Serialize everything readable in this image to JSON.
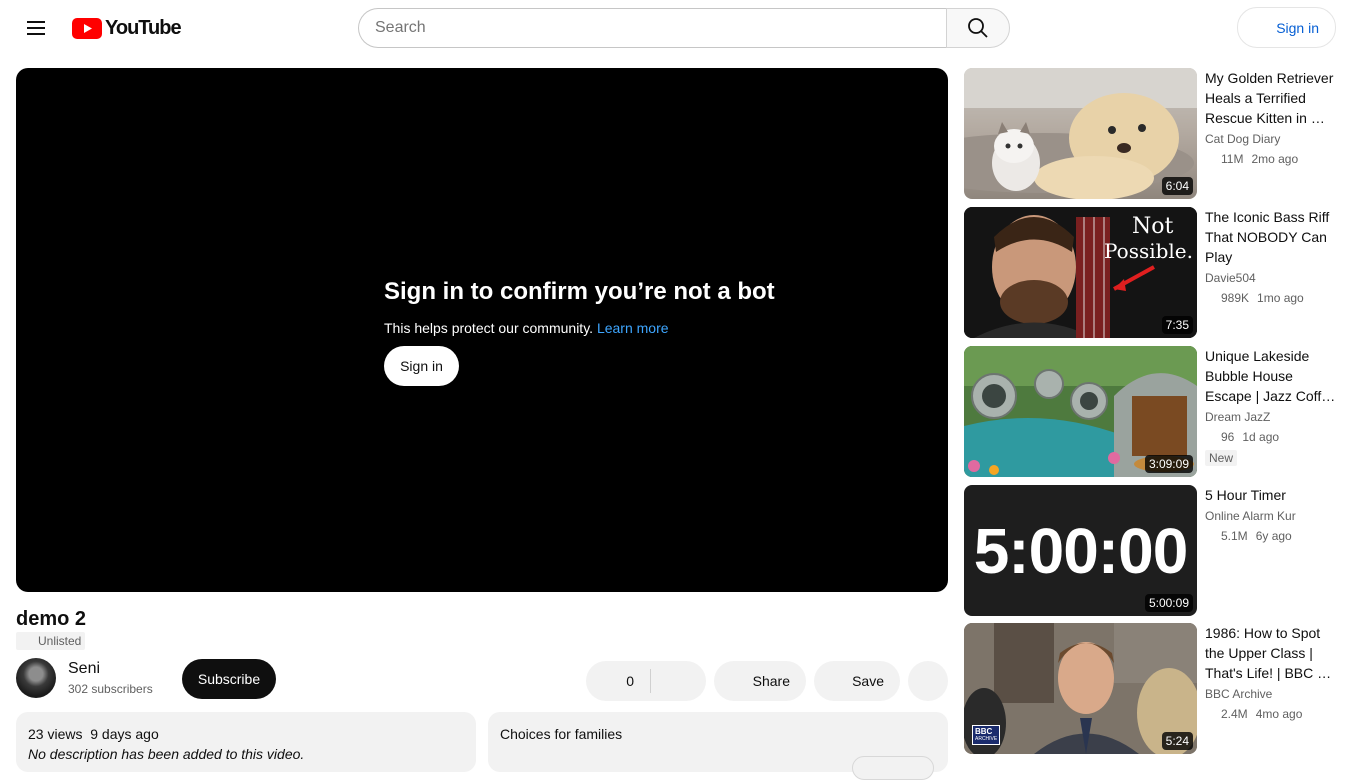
{
  "header": {
    "logo_text": "YouTube",
    "search_placeholder": "Search",
    "signin_label": "Sign in"
  },
  "player": {
    "prompt_title": "Sign in to confirm you’re not a bot",
    "prompt_text": "This helps protect our community.",
    "learn_more": "Learn more",
    "signin_label": "Sign in"
  },
  "video": {
    "title": "demo 2",
    "visibility": "Unlisted",
    "channel_name": "Seni",
    "subscribers": "302 subscribers",
    "subscribe_label": "Subscribe",
    "like_count": "0",
    "share_label": "Share",
    "save_label": "Save",
    "views": "23 views",
    "age": "9 days ago",
    "description": "No description has been added to this video.",
    "families_label": "Choices for families"
  },
  "recommendations": [
    {
      "title": "My Golden Retriever Heals a Terrified Rescue Kitten in …",
      "channel": "Cat Dog Diary",
      "views": "11M",
      "age": "2mo ago",
      "duration": "6:04",
      "badge": ""
    },
    {
      "title": "The Iconic Bass Riff That NOBODY Can Play",
      "channel": "Davie504",
      "views": "989K",
      "age": "1mo ago",
      "duration": "7:35",
      "badge": "",
      "thumb_text_1": "Not",
      "thumb_text_2": "Possible."
    },
    {
      "title": "Unique Lakeside Bubble House Escape | Jazz Coff…",
      "channel": "Dream JazZ",
      "views": "96",
      "age": "1d ago",
      "duration": "3:09:09",
      "badge": "New"
    },
    {
      "title": "5 Hour Timer",
      "channel": "Online Alarm Kur",
      "views": "5.1M",
      "age": "6y ago",
      "duration": "5:00:09",
      "badge": "",
      "thumb_text_1": "5:00:00"
    },
    {
      "title": "1986: How to Spot the Upper Class | That's Life! | BBC …",
      "channel": "BBC Archive",
      "views": "2.4M",
      "age": "4mo ago",
      "duration": "5:24",
      "badge": "",
      "thumb_text_1": "BBC",
      "thumb_text_2": "ARCHIVE"
    }
  ]
}
